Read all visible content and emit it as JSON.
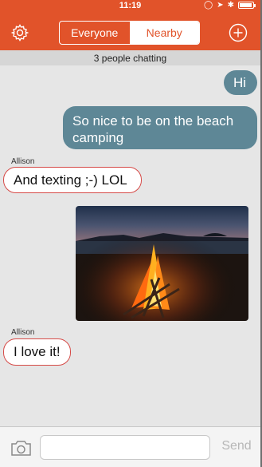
{
  "status_bar": {
    "time": "11:19"
  },
  "header": {
    "tabs": [
      {
        "label": "Everyone",
        "selected": false
      },
      {
        "label": "Nearby",
        "selected": true
      }
    ],
    "accent_color": "#e1532a"
  },
  "subheader": {
    "text": "3 people chatting"
  },
  "messages": [
    {
      "direction": "outgoing",
      "text": "Hi"
    },
    {
      "direction": "outgoing",
      "text": "So nice to be on the beach camping"
    },
    {
      "direction": "incoming",
      "sender": "Allison",
      "text": "And texting ;-) LOL"
    },
    {
      "direction": "outgoing",
      "type": "image",
      "image_icon": "campfire-beach-photo"
    },
    {
      "direction": "incoming",
      "sender": "Allison",
      "text": "I love it!"
    }
  ],
  "composer": {
    "input_value": "",
    "input_placeholder": "",
    "send_label": "Send",
    "camera_icon": "camera-icon"
  }
}
